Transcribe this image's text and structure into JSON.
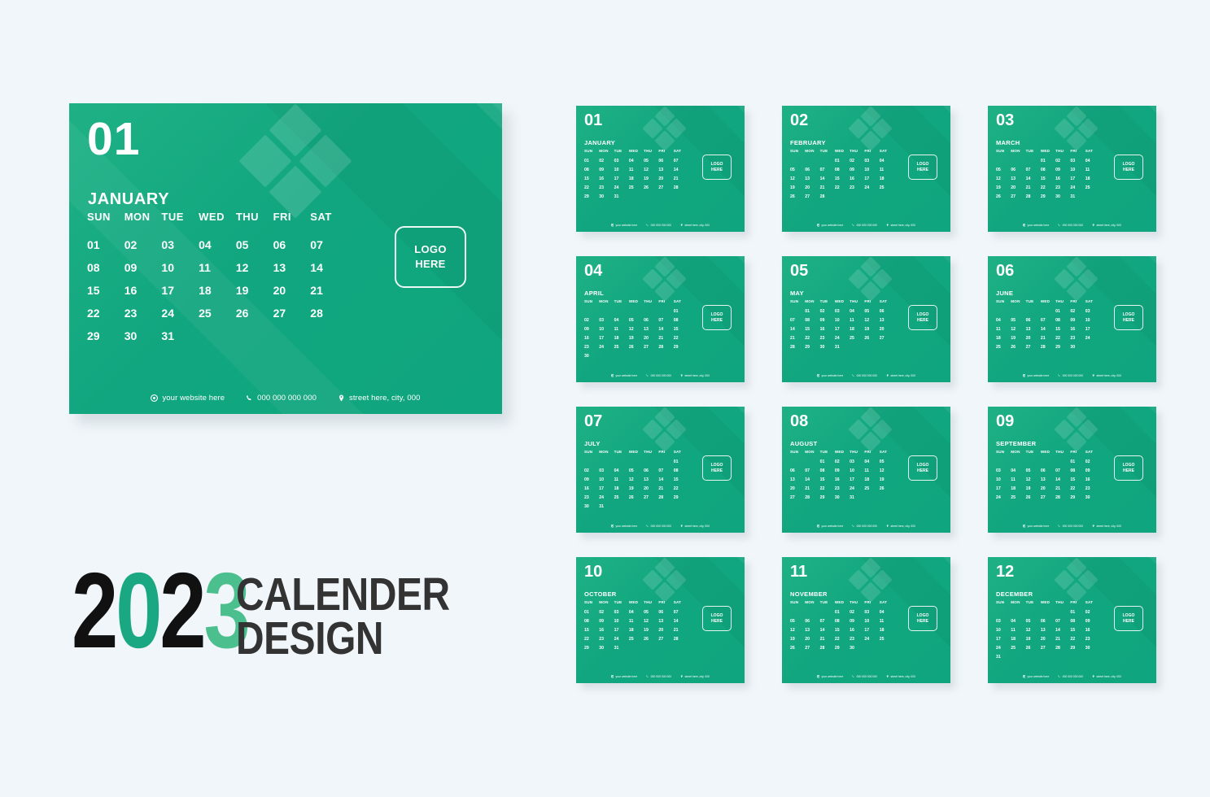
{
  "colors": {
    "page_background": "#f1f6fa",
    "card_green": "#11a67f",
    "card_green_light": "#1fb185",
    "year_black": "#111111",
    "year_teal": "#1aa882",
    "year_green": "#4cbf8e",
    "title_gray": "#333333"
  },
  "brand": {
    "year": "2023",
    "year_digits": [
      "2",
      "0",
      "2",
      "3"
    ],
    "title_line1": "CALENDER",
    "title_line2": "DESIGN"
  },
  "card_common": {
    "logo_line1": "LOGO",
    "logo_line2": "HERE",
    "weekdays": [
      "SUN",
      "MON",
      "TUE",
      "WED",
      "THU",
      "FRI",
      "SAT"
    ],
    "footer": {
      "website": "your website here",
      "phone": "000 000 000 000",
      "address": "street here, city, 000",
      "website_icon": "globe-icon",
      "phone_icon": "phone-icon",
      "address_icon": "location-pin-icon"
    }
  },
  "featured_month": {
    "number": "01",
    "name": "JANUARY"
  },
  "months": [
    {
      "number": "01",
      "name": "JANUARY",
      "lead_blanks": 0,
      "days": [
        "01",
        "02",
        "03",
        "04",
        "05",
        "06",
        "07",
        "08",
        "09",
        "10",
        "11",
        "12",
        "13",
        "14",
        "15",
        "16",
        "17",
        "18",
        "19",
        "20",
        "21",
        "22",
        "23",
        "24",
        "25",
        "26",
        "27",
        "28",
        "29",
        "30",
        "31"
      ]
    },
    {
      "number": "02",
      "name": "FEBRUARY",
      "lead_blanks": 3,
      "days": [
        "01",
        "02",
        "03",
        "04",
        "05",
        "06",
        "07",
        "08",
        "09",
        "10",
        "11",
        "12",
        "13",
        "14",
        "15",
        "16",
        "17",
        "18",
        "19",
        "20",
        "21",
        "22",
        "23",
        "24",
        "25",
        "26",
        "27",
        "28"
      ]
    },
    {
      "number": "03",
      "name": "MARCH",
      "lead_blanks": 3,
      "days": [
        "01",
        "02",
        "03",
        "04",
        "05",
        "06",
        "07",
        "08",
        "09",
        "10",
        "11",
        "12",
        "13",
        "14",
        "15",
        "16",
        "17",
        "18",
        "19",
        "20",
        "21",
        "22",
        "23",
        "24",
        "25",
        "26",
        "27",
        "28",
        "29",
        "30",
        "31"
      ]
    },
    {
      "number": "04",
      "name": "APRIL",
      "lead_blanks": 6,
      "days": [
        "01",
        "02",
        "03",
        "04",
        "05",
        "06",
        "07",
        "08",
        "09",
        "10",
        "11",
        "12",
        "13",
        "14",
        "15",
        "16",
        "17",
        "18",
        "19",
        "20",
        "21",
        "22",
        "23",
        "24",
        "25",
        "26",
        "27",
        "28",
        "29",
        "30"
      ]
    },
    {
      "number": "05",
      "name": "MAY",
      "lead_blanks": 1,
      "days": [
        "01",
        "02",
        "03",
        "04",
        "05",
        "06",
        "07",
        "08",
        "09",
        "10",
        "11",
        "12",
        "13",
        "14",
        "15",
        "16",
        "17",
        "18",
        "19",
        "20",
        "21",
        "22",
        "23",
        "24",
        "25",
        "26",
        "27",
        "28",
        "29",
        "30",
        "31"
      ]
    },
    {
      "number": "06",
      "name": "JUNE",
      "lead_blanks": 4,
      "days": [
        "01",
        "02",
        "03",
        "04",
        "05",
        "06",
        "07",
        "08",
        "09",
        "10",
        "11",
        "12",
        "13",
        "14",
        "15",
        "16",
        "17",
        "18",
        "19",
        "20",
        "21",
        "22",
        "23",
        "24",
        "25",
        "26",
        "27",
        "28",
        "29",
        "30"
      ]
    },
    {
      "number": "07",
      "name": "JULY",
      "lead_blanks": 6,
      "days": [
        "01",
        "02",
        "03",
        "04",
        "05",
        "06",
        "07",
        "08",
        "09",
        "10",
        "11",
        "12",
        "13",
        "14",
        "15",
        "16",
        "17",
        "18",
        "19",
        "20",
        "21",
        "22",
        "23",
        "24",
        "25",
        "26",
        "27",
        "28",
        "29",
        "30",
        "31"
      ]
    },
    {
      "number": "08",
      "name": "AUGUST",
      "lead_blanks": 2,
      "days": [
        "01",
        "02",
        "03",
        "04",
        "05",
        "06",
        "07",
        "08",
        "09",
        "10",
        "11",
        "12",
        "13",
        "14",
        "15",
        "16",
        "17",
        "18",
        "19",
        "20",
        "21",
        "22",
        "23",
        "24",
        "25",
        "26",
        "27",
        "28",
        "29",
        "30",
        "31"
      ]
    },
    {
      "number": "09",
      "name": "SEPTEMBER",
      "lead_blanks": 5,
      "days": [
        "01",
        "02",
        "03",
        "04",
        "05",
        "06",
        "07",
        "08",
        "09",
        "10",
        "11",
        "12",
        "13",
        "14",
        "15",
        "16",
        "17",
        "18",
        "19",
        "20",
        "21",
        "22",
        "23",
        "24",
        "25",
        "26",
        "27",
        "28",
        "29",
        "30"
      ]
    },
    {
      "number": "10",
      "name": "OCTOBER",
      "lead_blanks": 0,
      "days": [
        "01",
        "02",
        "03",
        "04",
        "05",
        "06",
        "07",
        "08",
        "09",
        "10",
        "11",
        "12",
        "13",
        "14",
        "15",
        "16",
        "17",
        "18",
        "19",
        "20",
        "21",
        "22",
        "23",
        "24",
        "25",
        "26",
        "27",
        "28",
        "29",
        "30",
        "31"
      ]
    },
    {
      "number": "11",
      "name": "NOVEMBER",
      "lead_blanks": 3,
      "days": [
        "01",
        "02",
        "03",
        "04",
        "05",
        "06",
        "07",
        "08",
        "09",
        "10",
        "11",
        "12",
        "13",
        "14",
        "15",
        "16",
        "17",
        "18",
        "19",
        "20",
        "21",
        "22",
        "23",
        "24",
        "25",
        "26",
        "27",
        "28",
        "29",
        "30"
      ]
    },
    {
      "number": "12",
      "name": "DECEMBER",
      "lead_blanks": 5,
      "days": [
        "01",
        "02",
        "03",
        "04",
        "05",
        "06",
        "07",
        "08",
        "09",
        "10",
        "11",
        "12",
        "13",
        "14",
        "15",
        "16",
        "17",
        "18",
        "19",
        "20",
        "21",
        "22",
        "23",
        "24",
        "25",
        "26",
        "27",
        "28",
        "29",
        "30",
        "31"
      ]
    }
  ]
}
